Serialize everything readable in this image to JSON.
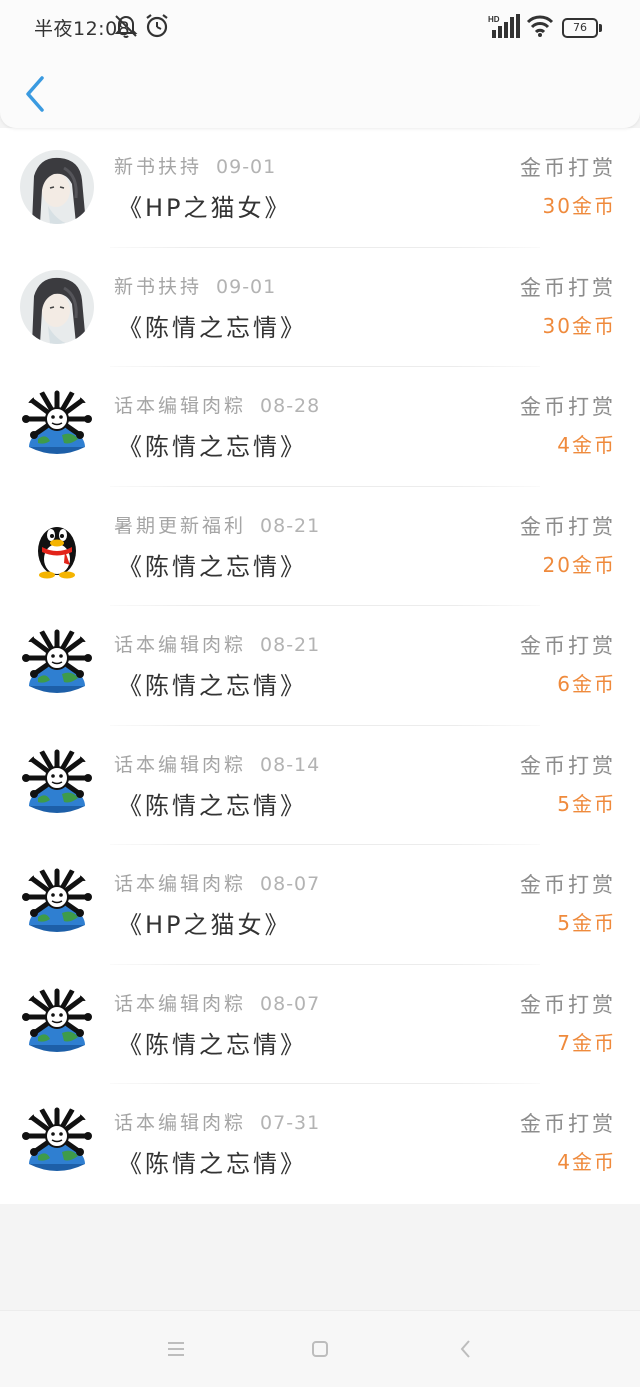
{
  "status": {
    "time": "半夜12:08",
    "battery": "76",
    "network": "HD"
  },
  "header": {
    "back_icon": "chevron-left-icon"
  },
  "colors": {
    "accent": "#3a9ae0",
    "reward": "#ef8a3c"
  },
  "items": [
    {
      "avatar": "anime",
      "source": "新书扶持",
      "date": "09-01",
      "book": "《HP之猫女》",
      "reward_type": "金币打赏",
      "amount": "30金币"
    },
    {
      "avatar": "anime",
      "source": "新书扶持",
      "date": "09-01",
      "book": "《陈情之忘情》",
      "reward_type": "金币打赏",
      "amount": "30金币"
    },
    {
      "avatar": "spider-globe",
      "source": "话本编辑肉粽",
      "date": "08-28",
      "book": "《陈情之忘情》",
      "reward_type": "金币打赏",
      "amount": "4金币"
    },
    {
      "avatar": "penguin",
      "source": "暑期更新福利",
      "date": "08-21",
      "book": "《陈情之忘情》",
      "reward_type": "金币打赏",
      "amount": "20金币"
    },
    {
      "avatar": "spider-globe",
      "source": "话本编辑肉粽",
      "date": "08-21",
      "book": "《陈情之忘情》",
      "reward_type": "金币打赏",
      "amount": "6金币"
    },
    {
      "avatar": "spider-globe",
      "source": "话本编辑肉粽",
      "date": "08-14",
      "book": "《陈情之忘情》",
      "reward_type": "金币打赏",
      "amount": "5金币"
    },
    {
      "avatar": "spider-globe",
      "source": "话本编辑肉粽",
      "date": "08-07",
      "book": "《HP之猫女》",
      "reward_type": "金币打赏",
      "amount": "5金币"
    },
    {
      "avatar": "spider-globe",
      "source": "话本编辑肉粽",
      "date": "08-07",
      "book": "《陈情之忘情》",
      "reward_type": "金币打赏",
      "amount": "7金币"
    },
    {
      "avatar": "spider-globe",
      "source": "话本编辑肉粽",
      "date": "07-31",
      "book": "《陈情之忘情》",
      "reward_type": "金币打赏",
      "amount": "4金币"
    }
  ],
  "navbar": {
    "icons": [
      "menu-icon",
      "home-icon",
      "back-icon"
    ]
  }
}
